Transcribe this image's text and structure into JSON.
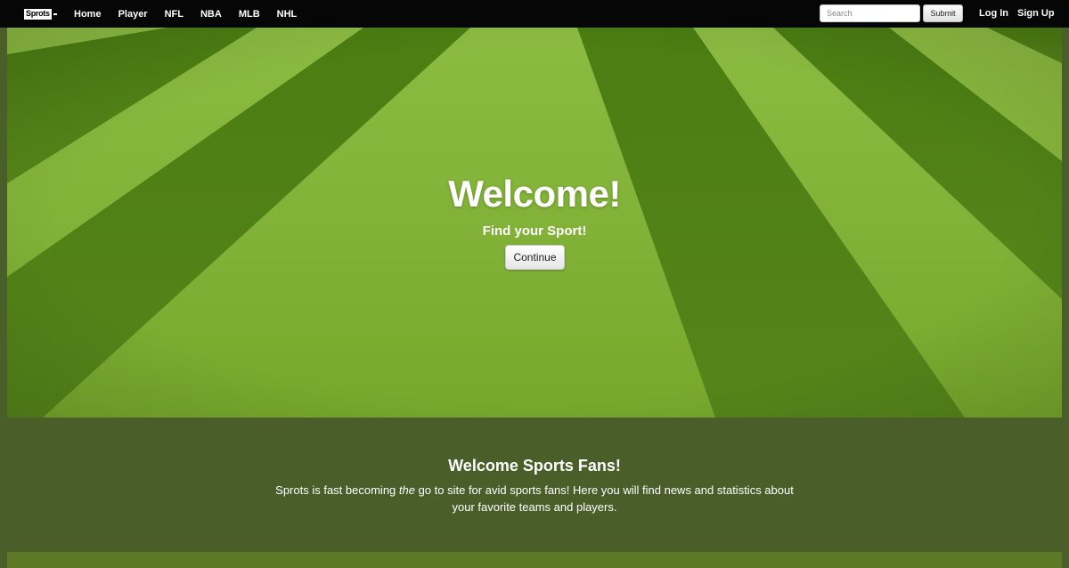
{
  "navbar": {
    "brand": "Sprots",
    "links": [
      "Home",
      "Player",
      "NFL",
      "NBA",
      "MLB",
      "NHL"
    ],
    "search_placeholder": "Search",
    "submit_label": "Submit",
    "login_label": "Log In",
    "signup_label": "Sign Up"
  },
  "hero": {
    "title": "Welcome!",
    "subtitle": "Find your Sport!",
    "button_label": "Continue"
  },
  "info": {
    "title": "Welcome Sports Fans!",
    "text_before": "Sprots is fast becoming ",
    "text_em": "the",
    "text_after": " go to site for avid sports fans! Here you will find news and statistics about your favorite teams and players."
  },
  "colors": {
    "navbar_bg": "#060606",
    "section_bg": "#4a5e2a",
    "grass_light": "#7fb034",
    "grass_dark": "#4f7f12"
  }
}
